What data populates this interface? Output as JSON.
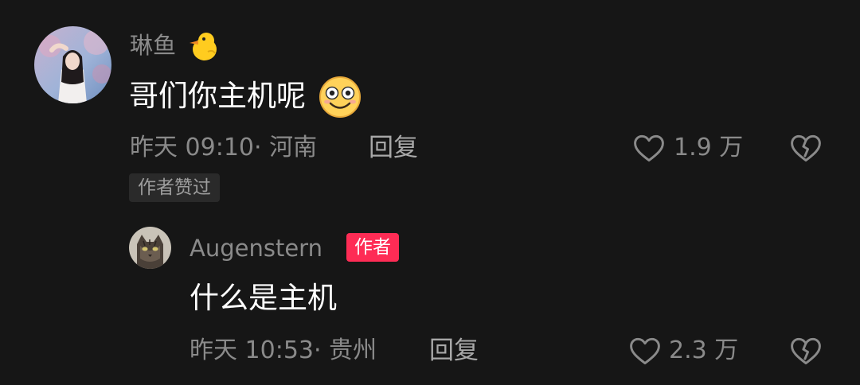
{
  "comment": {
    "user": {
      "name": "琳鱼",
      "name_emoji": "🐤"
    },
    "text": "哥们你主机呢",
    "text_emoji": "😊",
    "time": "昨天 09:10",
    "location": "· 河南",
    "reply_label": "回复",
    "like_count": "1.9 万",
    "liked_tag": "作者赞过",
    "icons": {
      "like": "heart-outline-icon",
      "dislike": "broken-heart-icon"
    }
  },
  "reply": {
    "user": {
      "name": "Augenstern"
    },
    "author_badge": "作者",
    "text": "什么是主机",
    "time": "昨天 10:53",
    "location": "· 贵州",
    "reply_label": "回复",
    "like_count": "2.3 万",
    "icons": {
      "like": "heart-outline-icon",
      "dislike": "broken-heart-icon"
    }
  },
  "colors": {
    "background": "#161616",
    "muted_text": "#8a8a8a",
    "author_badge": "#fe2c55"
  }
}
